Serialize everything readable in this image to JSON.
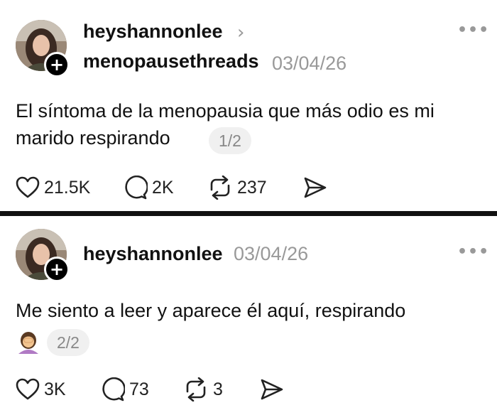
{
  "posts": [
    {
      "username": "heyshannonlee",
      "community": "menopausethreads",
      "date": "03/04/26",
      "text": "El síntoma de la menopausia que más odio es mi marido respirando",
      "page": "1/2",
      "likes": "21.5K",
      "replies": "2K",
      "reposts": "237"
    },
    {
      "username": "heyshannonlee",
      "date": "03/04/26",
      "text": "Me siento a leer y aparece él aquí, respirando",
      "page": "2/2",
      "likes": "3K",
      "replies": "73",
      "reposts": "3"
    }
  ],
  "icons": {
    "follow": "plus-icon",
    "more": "more-options-icon",
    "chevron": "chevron-right-icon",
    "like": "heart-icon",
    "reply": "comment-icon",
    "repost": "repost-icon",
    "share": "send-icon",
    "emoji": "woman-facepalming-emoji"
  },
  "colors": {
    "text": "#111111",
    "muted": "#999999",
    "divider": "#111111"
  }
}
